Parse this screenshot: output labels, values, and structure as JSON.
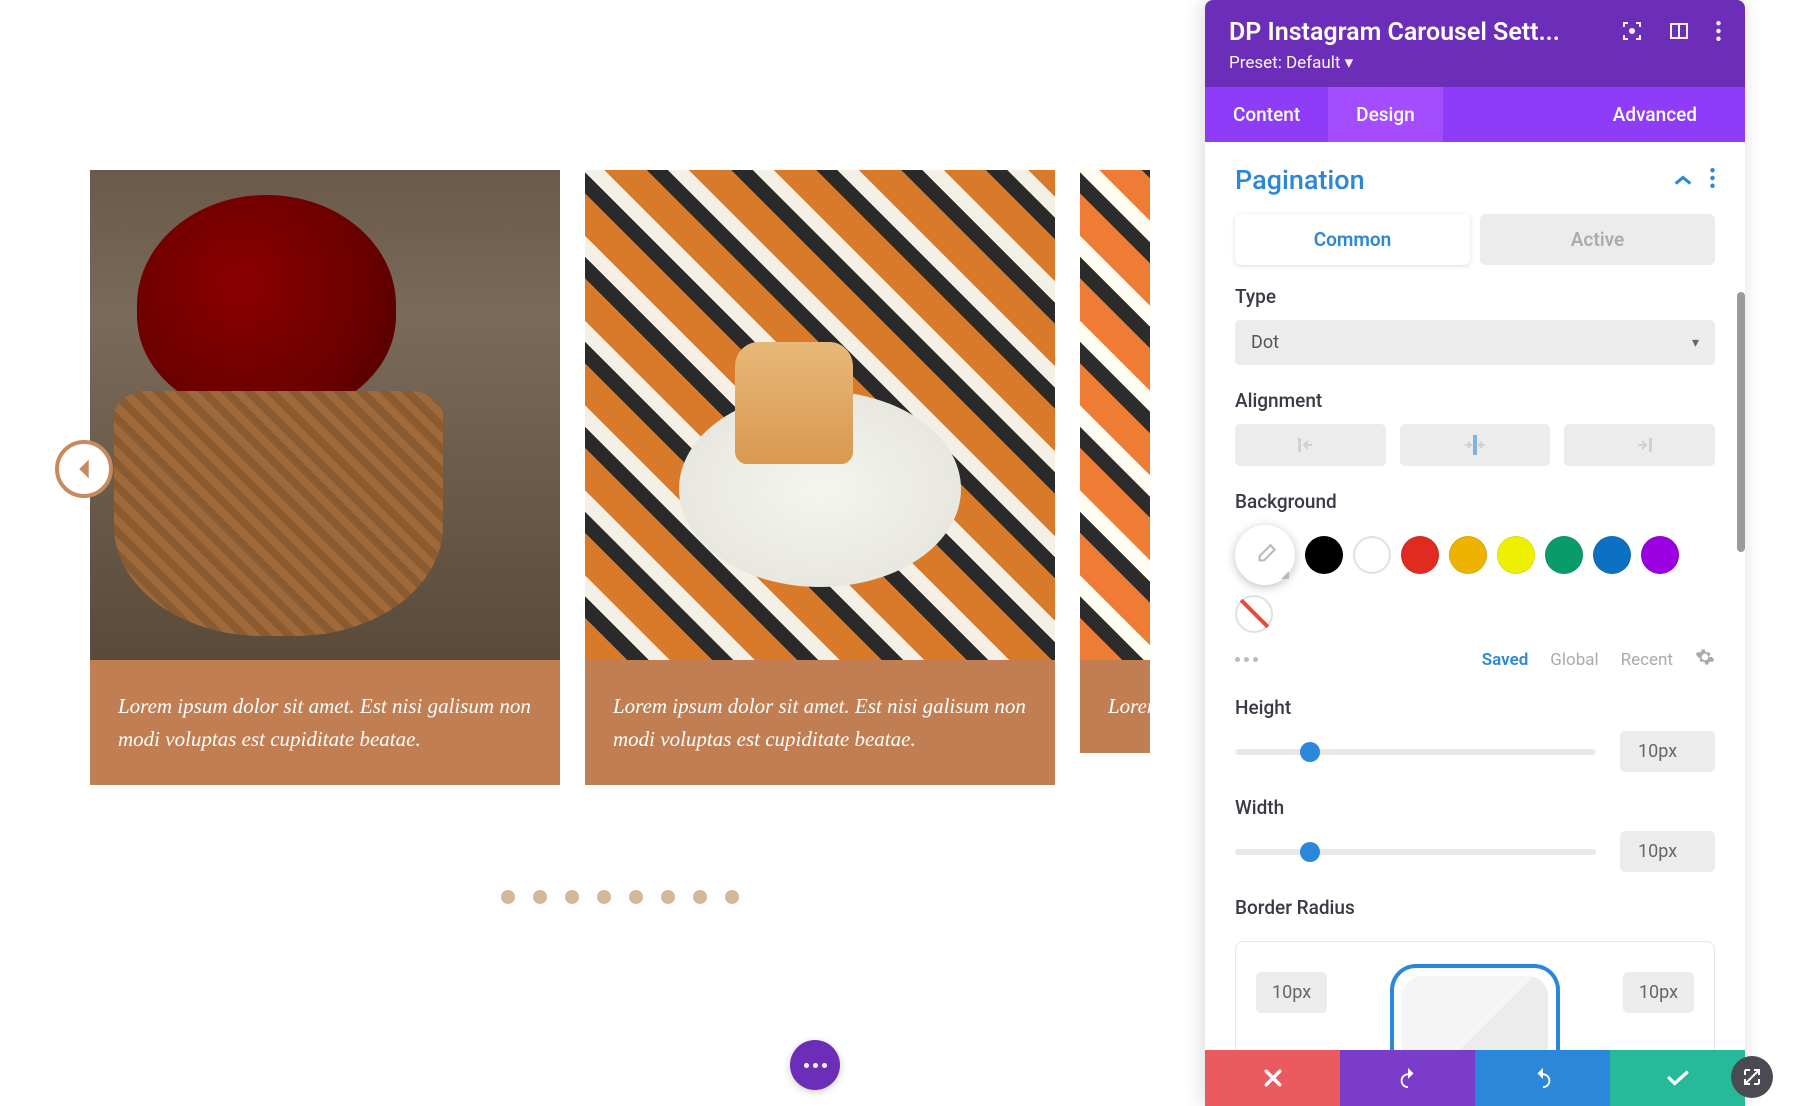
{
  "carousel": {
    "caption": "Lorem ipsum dolor sit amet. Est nisi galisum non modi voluptas est cupiditate beatae.",
    "dots_count": 8
  },
  "panel": {
    "title": "DP Instagram Carousel Sett...",
    "preset_label": "Preset: Default",
    "tabs": {
      "content": "Content",
      "design": "Design",
      "advanced": "Advanced"
    },
    "section_title": "Pagination",
    "sub_tabs": {
      "common": "Common",
      "active": "Active"
    },
    "type": {
      "label": "Type",
      "value": "Dot"
    },
    "alignment": {
      "label": "Alignment"
    },
    "background": {
      "label": "Background",
      "swatches": [
        "#000000",
        "#ffffff",
        "#e02b20",
        "#eeb300",
        "#edf000",
        "#0a9b6a",
        "#0c71c3",
        "#9b00e0"
      ],
      "meta_tabs": {
        "saved": "Saved",
        "global": "Global",
        "recent": "Recent"
      }
    },
    "height": {
      "label": "Height",
      "value": "10px"
    },
    "width": {
      "label": "Width",
      "value": "10px"
    },
    "border_radius": {
      "label": "Border Radius",
      "tl": "10px",
      "tr": "10px"
    }
  }
}
